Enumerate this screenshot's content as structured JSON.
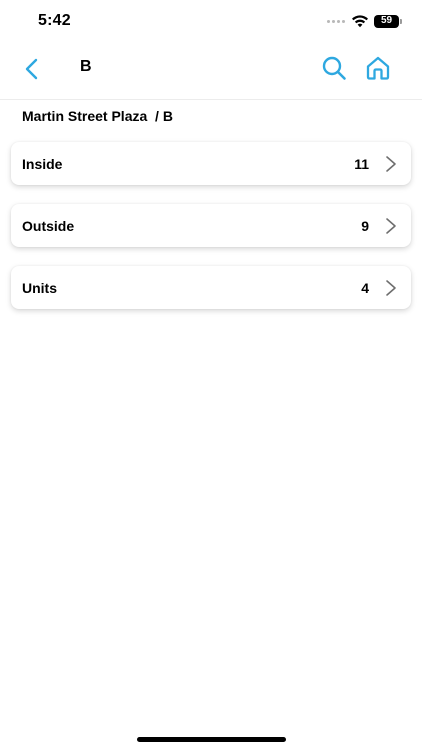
{
  "status_bar": {
    "time": "5:42",
    "battery": "59"
  },
  "nav": {
    "title": "B",
    "icons": [
      "chevron-left-icon",
      "search-icon",
      "home-icon"
    ],
    "accent_color": "#2ea8e0"
  },
  "breadcrumb": "Martin Street Plaza  / B",
  "rows": [
    {
      "label": "Inside",
      "count": "11"
    },
    {
      "label": "Outside",
      "count": "9"
    },
    {
      "label": "Units",
      "count": "4"
    }
  ]
}
